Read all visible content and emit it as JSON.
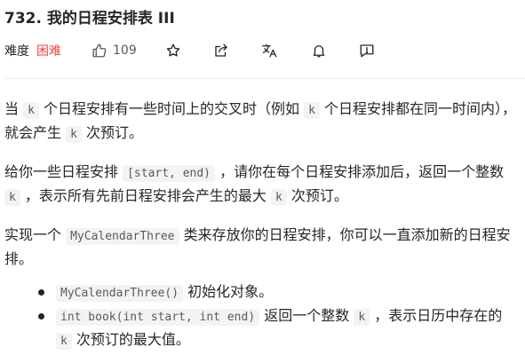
{
  "problem": {
    "number": "732.",
    "title": "我的日程安排表 III",
    "difficulty_label": "难度",
    "difficulty": "困难",
    "likes": "109",
    "colors": {
      "difficulty_hard": "#ef4743"
    },
    "icons": [
      "thumbs-up-icon",
      "star-icon",
      "share-icon",
      "translate-icon",
      "bell-icon",
      "feedback-icon"
    ]
  },
  "description": {
    "p1": {
      "t1": "当 ",
      "c1": "k",
      "t2": " 个日程安排有一些时间上的交叉时（例如 ",
      "c2": "k",
      "t3": " 个日程安排都在同一时间内），就会产生 ",
      "c3": "k",
      "t4": " 次预订。"
    },
    "p2": {
      "t1": "给你一些日程安排 ",
      "c1": "[start, end)",
      "t2": " ，请你在每个日程安排添加后，返回一个整数 ",
      "c2": "k",
      "t3": " ，表示所有先前日程安排会产生的最大 ",
      "c3": "k",
      "t4": " 次预订。"
    },
    "p3": {
      "t1": "实现一个 ",
      "c1": "MyCalendarThree",
      "t2": " 类来存放你的日程安排，你可以一直添加新的日程安排。"
    },
    "list": [
      {
        "c1": "MyCalendarThree()",
        "t1": " 初始化对象。"
      },
      {
        "c1": "int book(int start, int end)",
        "t1": " 返回一个整数 ",
        "c2": "k",
        "t2": " ，表示日历中存在的 ",
        "c3": "k",
        "t3": " 次预订的最大值。"
      }
    ]
  }
}
